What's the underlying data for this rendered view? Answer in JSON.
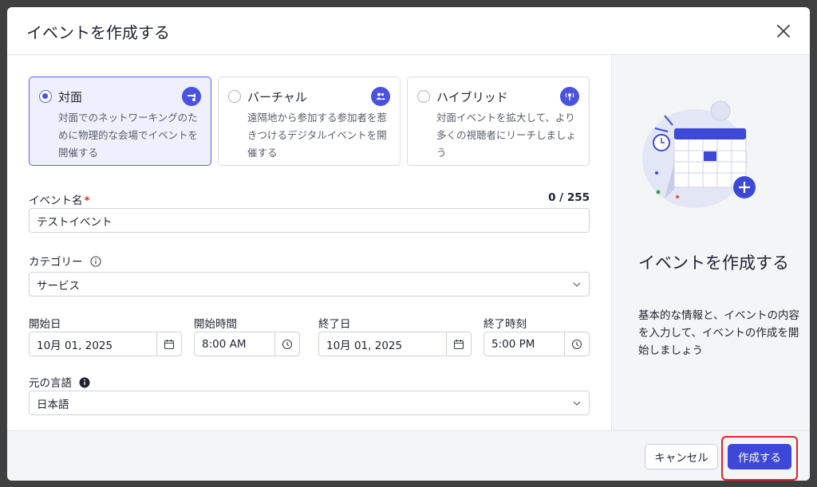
{
  "modal": {
    "title": "イベントを作成する"
  },
  "event_types": [
    {
      "label": "対面",
      "description": "対面でのネットワーキングのために物理的な会場でイベントを開催する",
      "icon": "in-person-icon",
      "selected": true
    },
    {
      "label": "バーチャル",
      "description": "遠隔地から参加する参加者を惹きつけるデジタルイベントを開催する",
      "icon": "virtual-icon",
      "selected": false
    },
    {
      "label": "ハイブリッド",
      "description": "対面イベントを拡大して、より多くの視聴者にリーチしましょう",
      "icon": "hybrid-icon",
      "selected": false
    }
  ],
  "form": {
    "event_name": {
      "label": "イベント名",
      "required_mark": "*",
      "value": "テストイベント",
      "counter": "0 / 255"
    },
    "category": {
      "label": "カテゴリー",
      "value": "サービス"
    },
    "start_date": {
      "label": "開始日",
      "value": "10月 01, 2025"
    },
    "start_time": {
      "label": "開始時間",
      "value": "8:00 AM"
    },
    "end_date": {
      "label": "終了日",
      "value": "10月 01, 2025"
    },
    "end_time": {
      "label": "終了時刻",
      "value": "5:00 PM"
    },
    "language": {
      "label": "元の言語",
      "value": "日本語"
    }
  },
  "panel": {
    "title": "イベントを作成する",
    "description": "基本的な情報と、イベントの内容を入力して、イベントの作成を開始しましょう"
  },
  "footer": {
    "cancel_label": "キャンセル",
    "create_label": "作成する"
  },
  "colors": {
    "accent": "#3e48d8",
    "selected_card_bg": "#eef0fd",
    "highlight": "#e0252a"
  }
}
